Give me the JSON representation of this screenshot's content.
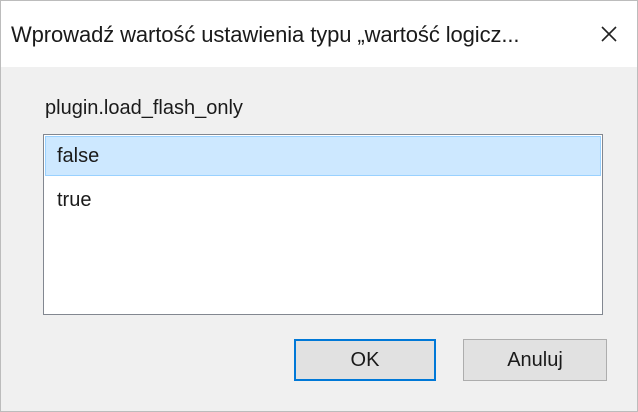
{
  "dialog": {
    "title": "Wprowadź wartość ustawienia typu „wartość logicz...",
    "close_icon": "close-icon",
    "preference_name": "plugin.load_flash_only",
    "options": [
      {
        "label": "false",
        "selected": true
      },
      {
        "label": "true",
        "selected": false
      }
    ],
    "ok_label": "OK",
    "cancel_label": "Anuluj"
  },
  "colors": {
    "selection_background": "#cde8ff",
    "selection_border": "#99d1ff",
    "default_button_border": "#0078d7",
    "button_background": "#e1e1e1"
  }
}
